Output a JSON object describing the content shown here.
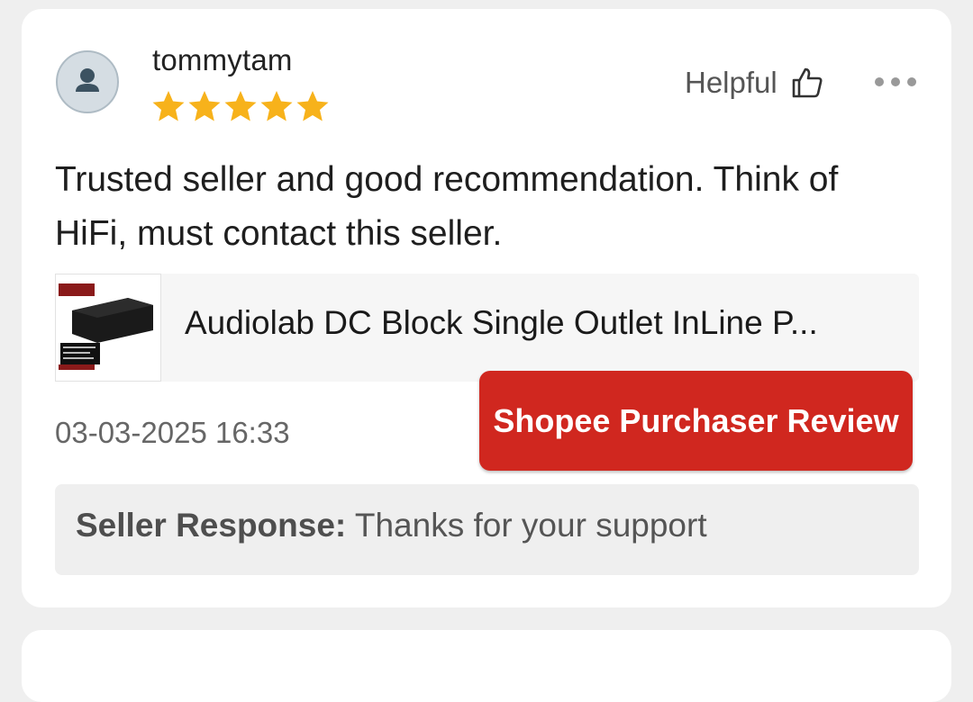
{
  "review": {
    "username": "tommytam",
    "rating": 5,
    "rating_max": 5,
    "helpful_label": "Helpful",
    "text": "Trusted seller and good recommendation. Think of HiFi, must contact this seller.",
    "product_name": "Audiolab DC Block Single Outlet InLine P...",
    "date": "03-03-2025 16:33",
    "badge": "Shopee Purchaser Review",
    "seller_response_label": "Seller Response:",
    "seller_response_text": "Thanks for your support"
  },
  "colors": {
    "star": "#f7b21b",
    "badge": "#d0271f",
    "avatar_bg": "#d5dde3"
  },
  "icons": {
    "avatar": "person-icon",
    "helpful": "thumbs-up-icon",
    "more": "more-dots-icon",
    "star": "star-icon"
  }
}
